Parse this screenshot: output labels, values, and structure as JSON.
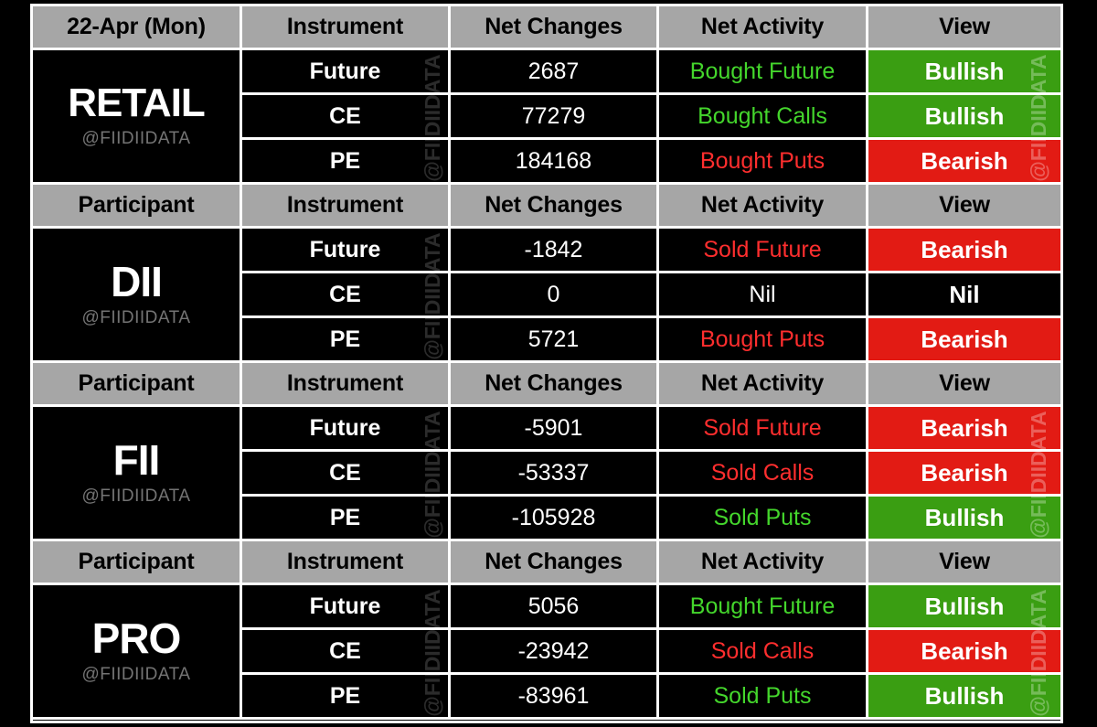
{
  "watermark": {
    "center": "@FIIDIIDATA",
    "vertical": "@FIIDIIDATA"
  },
  "colors": {
    "header_bg": "#a6a6a6",
    "bullish_bg": "#3a9e12",
    "bearish_bg": "#e21b14",
    "nil_bg": "#000000",
    "bought_text": "#44d62c",
    "sold_text": "#ff2e2e",
    "border": "#ffffff",
    "page_bg": "#000000"
  },
  "columns": {
    "participant": "Participant",
    "date": "22-Apr (Mon)",
    "instrument": "Instrument",
    "net_changes": "Net Changes",
    "net_activity": "Net Activity",
    "view": "View"
  },
  "groups": [
    {
      "participant": "RETAIL",
      "handle": "@FIIDIIDATA",
      "header_first_cell": "22-Apr (Mon)",
      "rows": [
        {
          "instrument": "Future",
          "net_changes": "2687",
          "net_activity": "Bought Future",
          "activity_color": "green",
          "view": "Bullish",
          "view_bg": "green"
        },
        {
          "instrument": "CE",
          "net_changes": "77279",
          "net_activity": "Bought Calls",
          "activity_color": "green",
          "view": "Bullish",
          "view_bg": "green"
        },
        {
          "instrument": "PE",
          "net_changes": "184168",
          "net_activity": "Bought Puts",
          "activity_color": "red",
          "view": "Bearish",
          "view_bg": "red"
        }
      ]
    },
    {
      "participant": "DII",
      "handle": "@FIIDIIDATA",
      "header_first_cell": "Participant",
      "rows": [
        {
          "instrument": "Future",
          "net_changes": "-1842",
          "net_activity": "Sold Future",
          "activity_color": "red",
          "view": "Bearish",
          "view_bg": "red"
        },
        {
          "instrument": "CE",
          "net_changes": "0",
          "net_activity": "Nil",
          "activity_color": "white",
          "view": "Nil",
          "view_bg": "black"
        },
        {
          "instrument": "PE",
          "net_changes": "5721",
          "net_activity": "Bought Puts",
          "activity_color": "red",
          "view": "Bearish",
          "view_bg": "red"
        }
      ]
    },
    {
      "participant": "FII",
      "handle": "@FIIDIIDATA",
      "header_first_cell": "Participant",
      "rows": [
        {
          "instrument": "Future",
          "net_changes": "-5901",
          "net_activity": "Sold Future",
          "activity_color": "red",
          "view": "Bearish",
          "view_bg": "red"
        },
        {
          "instrument": "CE",
          "net_changes": "-53337",
          "net_activity": "Sold Calls",
          "activity_color": "red",
          "view": "Bearish",
          "view_bg": "red"
        },
        {
          "instrument": "PE",
          "net_changes": "-105928",
          "net_activity": "Sold Puts",
          "activity_color": "green",
          "view": "Bullish",
          "view_bg": "green"
        }
      ]
    },
    {
      "participant": "PRO",
      "handle": "@FIIDIIDATA",
      "header_first_cell": "Participant",
      "rows": [
        {
          "instrument": "Future",
          "net_changes": "5056",
          "net_activity": "Bought Future",
          "activity_color": "green",
          "view": "Bullish",
          "view_bg": "green"
        },
        {
          "instrument": "CE",
          "net_changes": "-23942",
          "net_activity": "Sold Calls",
          "activity_color": "red",
          "view": "Bearish",
          "view_bg": "red"
        },
        {
          "instrument": "PE",
          "net_changes": "-83961",
          "net_activity": "Sold Puts",
          "activity_color": "green",
          "view": "Bullish",
          "view_bg": "green"
        }
      ]
    }
  ]
}
